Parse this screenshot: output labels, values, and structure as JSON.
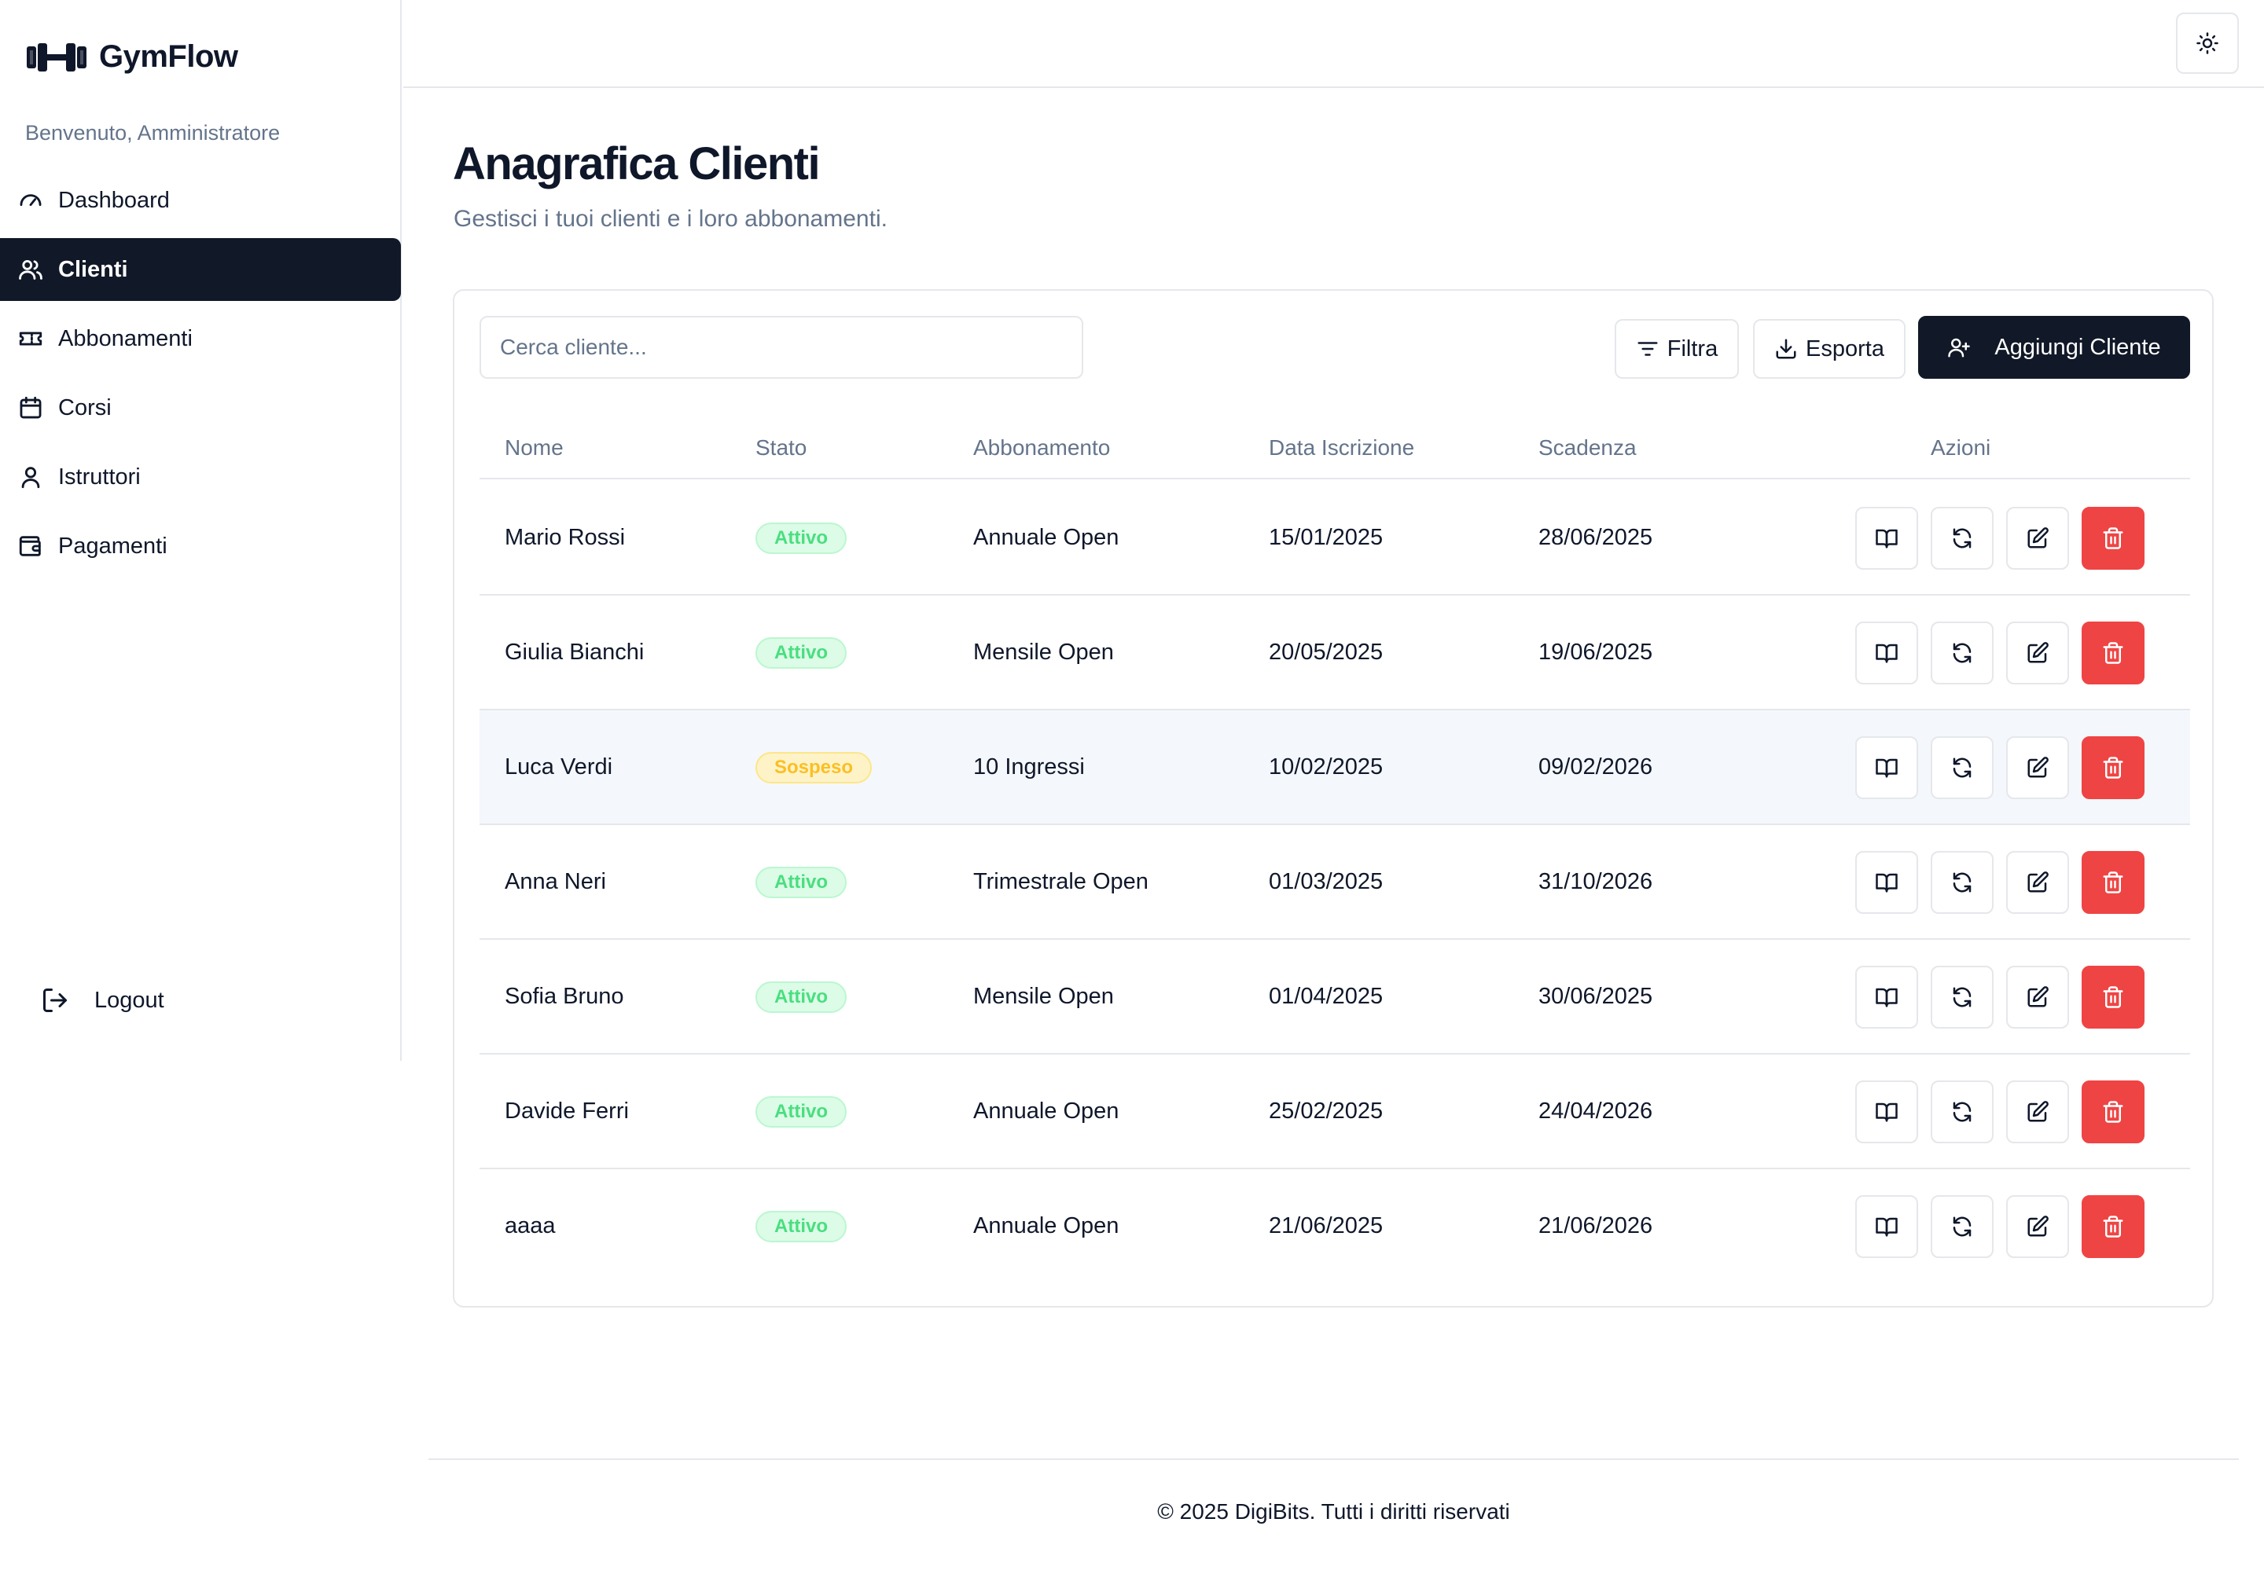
{
  "brand": {
    "name": "GymFlow"
  },
  "sidebar": {
    "welcome": "Benvenuto, Amministratore",
    "items": [
      {
        "label": "Dashboard",
        "icon": "gauge-icon"
      },
      {
        "label": "Clienti",
        "icon": "users-icon",
        "active": true
      },
      {
        "label": "Abbonamenti",
        "icon": "ticket-icon"
      },
      {
        "label": "Corsi",
        "icon": "calendar-icon"
      },
      {
        "label": "Istruttori",
        "icon": "user-icon"
      },
      {
        "label": "Pagamenti",
        "icon": "wallet-icon"
      }
    ],
    "logout": "Logout"
  },
  "header": {
    "theme_toggle_icon": "sun-icon"
  },
  "page": {
    "title": "Anagrafica Clienti",
    "subtitle": "Gestisci i tuoi clienti e i loro abbonamenti."
  },
  "toolbar": {
    "search_placeholder": "Cerca cliente...",
    "filter_label": "Filtra",
    "export_label": "Esporta",
    "add_label": "Aggiungi Cliente"
  },
  "table": {
    "columns": {
      "name": "Nome",
      "status": "Stato",
      "plan": "Abbonamento",
      "joined": "Data Iscrizione",
      "expiry": "Scadenza",
      "actions": "Azioni"
    },
    "rows": [
      {
        "name": "Mario Rossi",
        "status": "Attivo",
        "plan": "Annuale Open",
        "joined": "15/01/2025",
        "expiry": "28/06/2025"
      },
      {
        "name": "Giulia Bianchi",
        "status": "Attivo",
        "plan": "Mensile Open",
        "joined": "20/05/2025",
        "expiry": "19/06/2025"
      },
      {
        "name": "Luca Verdi",
        "status": "Sospeso",
        "plan": "10 Ingressi",
        "joined": "10/02/2025",
        "expiry": "09/02/2026"
      },
      {
        "name": "Anna Neri",
        "status": "Attivo",
        "plan": "Trimestrale Open",
        "joined": "01/03/2025",
        "expiry": "31/10/2026"
      },
      {
        "name": "Sofia Bruno",
        "status": "Attivo",
        "plan": "Mensile Open",
        "joined": "01/04/2025",
        "expiry": "30/06/2025"
      },
      {
        "name": "Davide Ferri",
        "status": "Attivo",
        "plan": "Annuale Open",
        "joined": "25/02/2025",
        "expiry": "24/04/2026"
      },
      {
        "name": "aaaa",
        "status": "Attivo",
        "plan": "Annuale Open",
        "joined": "21/06/2025",
        "expiry": "21/06/2026"
      }
    ]
  },
  "colors": {
    "primary": "#111827",
    "danger": "#ef4444",
    "active_badge": "#4ade80",
    "suspended_badge": "#fbbf24"
  },
  "footer": {
    "text": "© 2025 DigiBits. Tutti i diritti riservati"
  }
}
